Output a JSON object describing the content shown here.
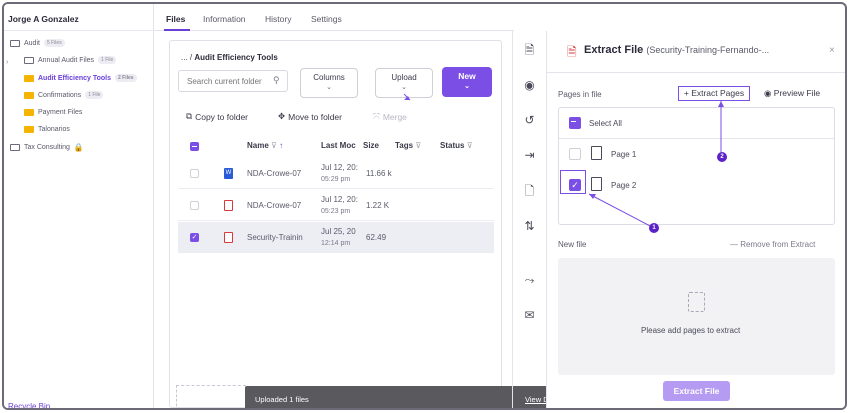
{
  "sidebar": {
    "user_name": "Jorge A Gonzalez",
    "items": [
      {
        "label": "Audit",
        "badge": "5 Files"
      },
      {
        "label": "Annual Audit Files",
        "badge": "1 File"
      },
      {
        "label": "Audit Efficiency Tools",
        "badge": "2 Files"
      },
      {
        "label": "Confirmations",
        "badge": "1 File"
      },
      {
        "label": "Payment Files",
        "badge": ""
      },
      {
        "label": "Talonarios",
        "badge": ""
      },
      {
        "label": "Tax Consulting",
        "badge": ""
      }
    ],
    "recycle_bin": "Recycle Bin"
  },
  "tabs": [
    "Files",
    "Information",
    "History",
    "Settings"
  ],
  "panel": {
    "breadcrumb_root": "...",
    "breadcrumb_sep": "/",
    "breadcrumb_current": "Audit Efficiency Tools",
    "search_placeholder": "Search current folder",
    "columns_label": "Columns",
    "upload_label": "Upload",
    "new_label": "New",
    "copy_label": "Copy to folder",
    "move_label": "Move to folder",
    "merge_label": "Merge",
    "headers": {
      "name": "Name",
      "last_modified": "Last Moc",
      "size": "Size",
      "tags": "Tags",
      "status": "Status"
    },
    "rows": [
      {
        "name": "NDA-Crowe-07",
        "date": "Jul 12, 20:",
        "time": "05:29 pm",
        "size": "11.66 k",
        "type": "word",
        "selected": false
      },
      {
        "name": "NDA-Crowe-07",
        "date": "Jul 12, 20:",
        "time": "05:23 pm",
        "size": "1.22 K",
        "type": "pdf",
        "selected": false
      },
      {
        "name": "Security-Trainin",
        "date": "Jul 25, 20",
        "time": "12:14 pm",
        "size": "62.49",
        "type": "pdf",
        "selected": true
      }
    ]
  },
  "toast": {
    "message": "Uploaded 1 files",
    "link": "View Details",
    "close": "✕"
  },
  "extract": {
    "title": "Extract File",
    "subtitle": "(Security-Training-Fernando-...",
    "close": "×",
    "pages_in_file": "Pages in file",
    "extract_pages_btn": "+ Extract Pages",
    "preview_btn": "Preview File",
    "select_all": "Select All",
    "pages": [
      {
        "label": "Page 1",
        "checked": false
      },
      {
        "label": "Page 2",
        "checked": true
      }
    ],
    "new_file": "New file",
    "remove": "— Remove from Extract",
    "empty_msg": "Please add pages to extract",
    "extract_btn": "Extract File"
  },
  "annotations": [
    "1",
    "2"
  ],
  "colors": {
    "accent": "#7b4fe6",
    "annotation": "#5b22c8",
    "pdf": "#d63a3a",
    "word": "#2a5bd7",
    "folder": "#f5b400"
  }
}
